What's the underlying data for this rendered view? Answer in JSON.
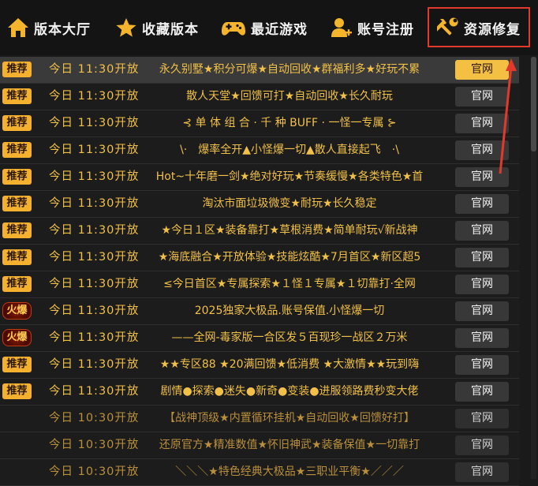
{
  "nav": {
    "items": [
      {
        "label": "版本大厅",
        "icon": "home-icon"
      },
      {
        "label": "收藏版本",
        "icon": "star-icon"
      },
      {
        "label": "最近游戏",
        "icon": "gamepad-icon"
      },
      {
        "label": "账号注册",
        "icon": "add-user-icon"
      },
      {
        "label": "资源修复",
        "icon": "tools-icon"
      }
    ]
  },
  "colors": {
    "accent": "#f4c043",
    "highlight_border": "#e13a2c",
    "text_gold": "#f1c048"
  },
  "rows": [
    {
      "badge": "推荐",
      "badge_type": "recommend",
      "time": "今日 11:30开放",
      "title": "永久别墅★积分可爆★自动回收★群福利多★好玩不累",
      "button": "官网"
    },
    {
      "badge": "推荐",
      "badge_type": "recommend",
      "time": "今日 11:30开放",
      "title": "散人天堂★回馈可打★自动回收★长久耐玩",
      "button": "官网"
    },
    {
      "badge": "推荐",
      "badge_type": "recommend",
      "time": "今日 11:30开放",
      "title": "⊰ 单 体 组 合 · 千 种 BUFF · 一怪一专属 ⊱",
      "button": "官网"
    },
    {
      "badge": "推荐",
      "badge_type": "recommend",
      "time": "今日 11:30开放",
      "title": "\\·　爆率全开▲小怪爆一切▲散人直接起飞　·\\",
      "button": "官网"
    },
    {
      "badge": "推荐",
      "badge_type": "recommend",
      "time": "今日 11:30开放",
      "title": "Hot~十年磨一剑★绝对好玩★节奏缓慢★各类特色★首",
      "button": "官网"
    },
    {
      "badge": "推荐",
      "badge_type": "recommend",
      "time": "今日 11:30开放",
      "title": "淘汰市面垃圾微变★耐玩★长久稳定",
      "button": "官网"
    },
    {
      "badge": "推荐",
      "badge_type": "recommend",
      "time": "今日 11:30开放",
      "title": "★今日１区★装备靠打★草根消费★简单耐玩√新战神",
      "button": "官网"
    },
    {
      "badge": "推荐",
      "badge_type": "recommend",
      "time": "今日 11:30开放",
      "title": "★海底融合★开放体验★技能炫酷★7月首区★新区超5",
      "button": "官网"
    },
    {
      "badge": "推荐",
      "badge_type": "recommend",
      "time": "今日 11:30开放",
      "title": "≤今日首区★专属探索★１怪１专属★１切靠打·全网",
      "button": "官网"
    },
    {
      "badge": "火爆",
      "badge_type": "hot",
      "time": "今日 11:30开放",
      "title": "2025独家大极品.账号保值.小怪爆一切",
      "button": "官网"
    },
    {
      "badge": "火爆",
      "badge_type": "hot",
      "time": "今日 11:30开放",
      "title": "——全网-毒家版一合区发５百现珍一战区２万米",
      "button": "官网"
    },
    {
      "badge": "推荐",
      "badge_type": "recommend",
      "time": "今日 11:30开放",
      "title": "★★专区88 ★20满回馈★低消费 ★大激情★★玩到嗨",
      "button": "官网"
    },
    {
      "badge": "推荐",
      "badge_type": "recommend",
      "time": "今日 11:30开放",
      "title": "剧情●探索●迷失●新奇●变装●进服领路费秒变大佬",
      "button": "官网"
    },
    {
      "badge": "",
      "badge_type": "none",
      "time": "今日 10:30开放",
      "title": "【战神顶级★内置循环挂机★自动回收★回馈好打】",
      "button": "官网"
    },
    {
      "badge": "",
      "badge_type": "none",
      "time": "今日 10:30开放",
      "title": "还原官方★精准数值★怀旧神武★装备保值★一切靠打",
      "button": "官网"
    },
    {
      "badge": "",
      "badge_type": "none",
      "time": "今日 10:30开放",
      "title": "＼＼＼★特色经典大极品★三职业平衡★／／／",
      "button": "官网"
    }
  ]
}
